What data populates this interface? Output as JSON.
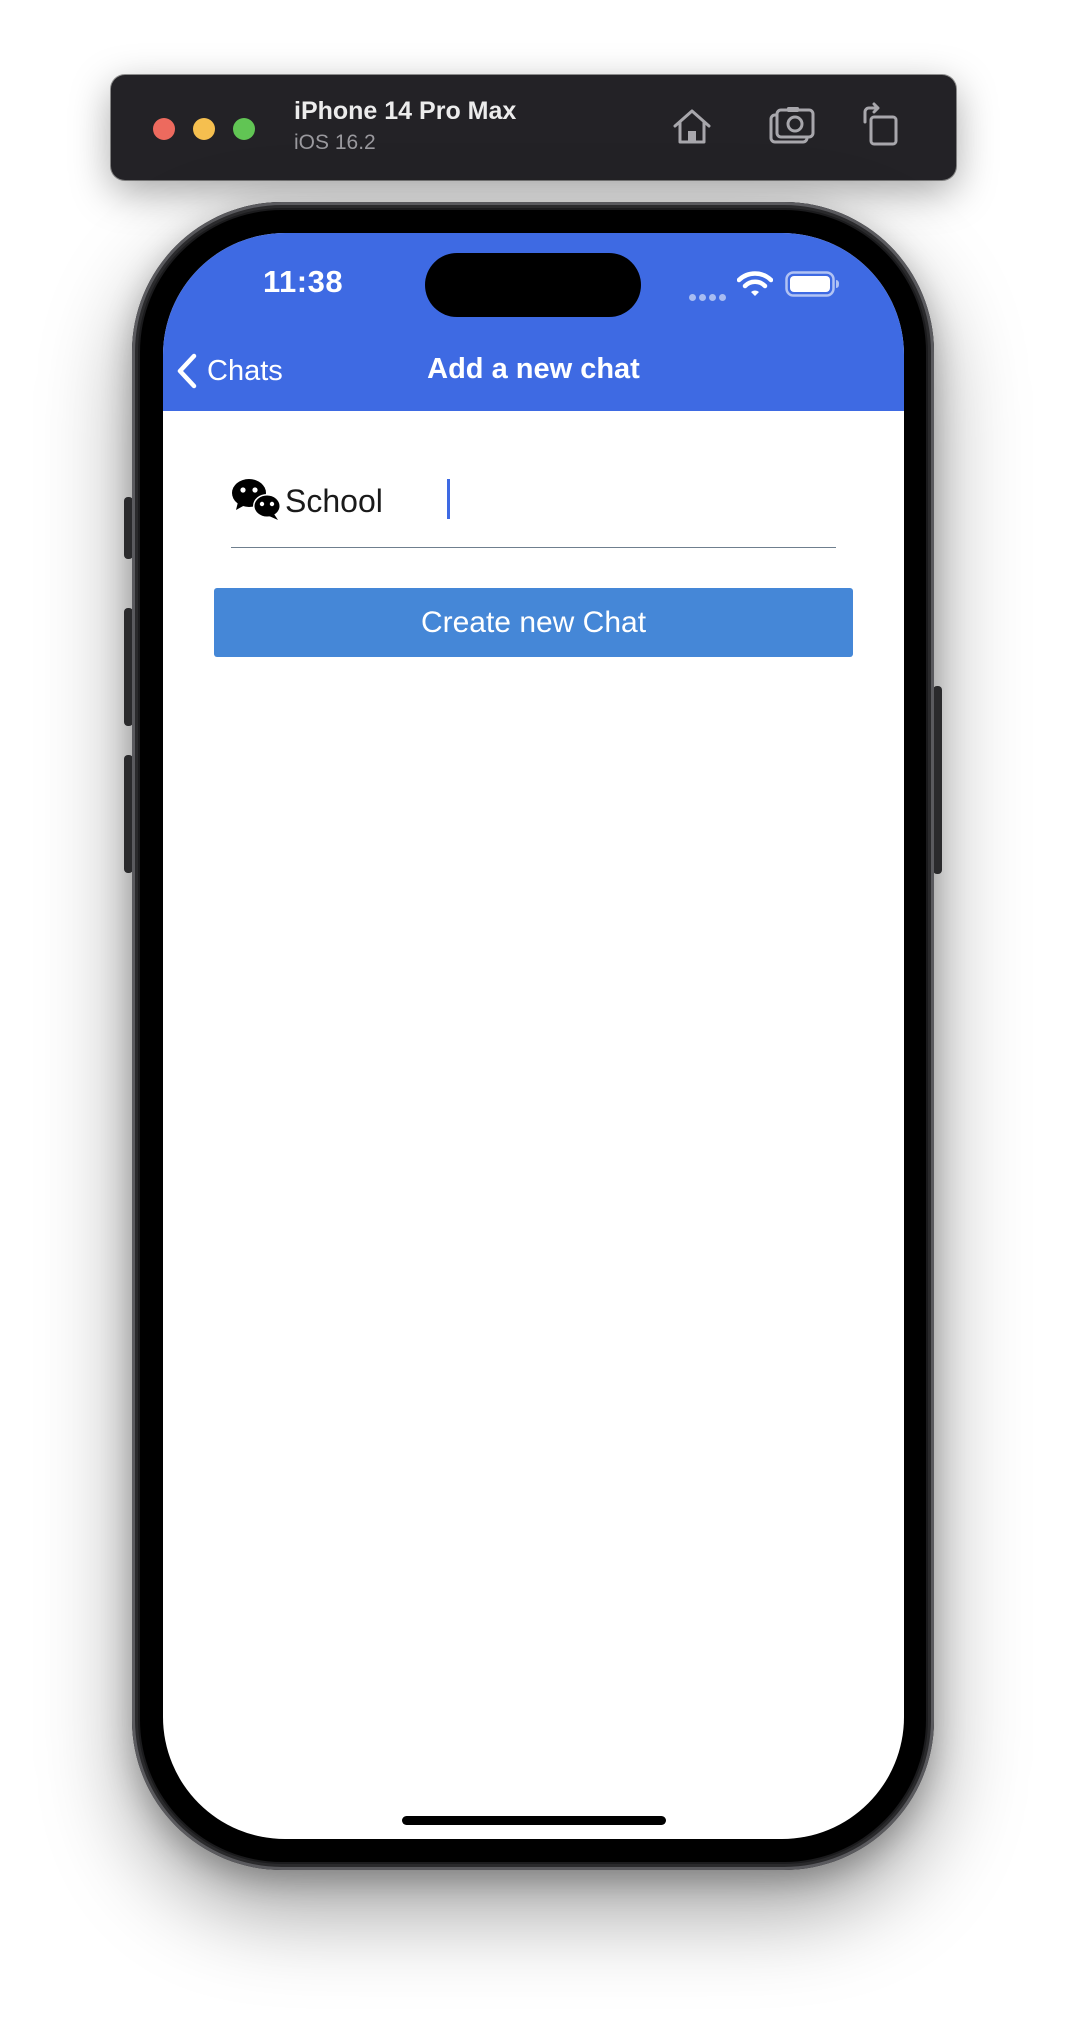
{
  "simulator": {
    "device_name": "iPhone 14 Pro Max",
    "os_version": "iOS 16.2",
    "icons": [
      "home-icon",
      "screenshot-icon",
      "rotate-icon"
    ]
  },
  "status_bar": {
    "time": "11:38",
    "icons": [
      "cellular-dots-icon",
      "wifi-icon",
      "battery-icon"
    ]
  },
  "nav": {
    "back_label": "Chats",
    "title": "Add a new chat"
  },
  "form": {
    "chat_name_value": "School",
    "chat_icon": "wechat-icon",
    "create_button_label": "Create new Chat"
  },
  "colors": {
    "header_bg": "#3e6ae3",
    "button_bg": "#4587d7",
    "traffic_red": "#ed6a5e",
    "traffic_yellow": "#f5bf4f",
    "traffic_green": "#61c554"
  }
}
